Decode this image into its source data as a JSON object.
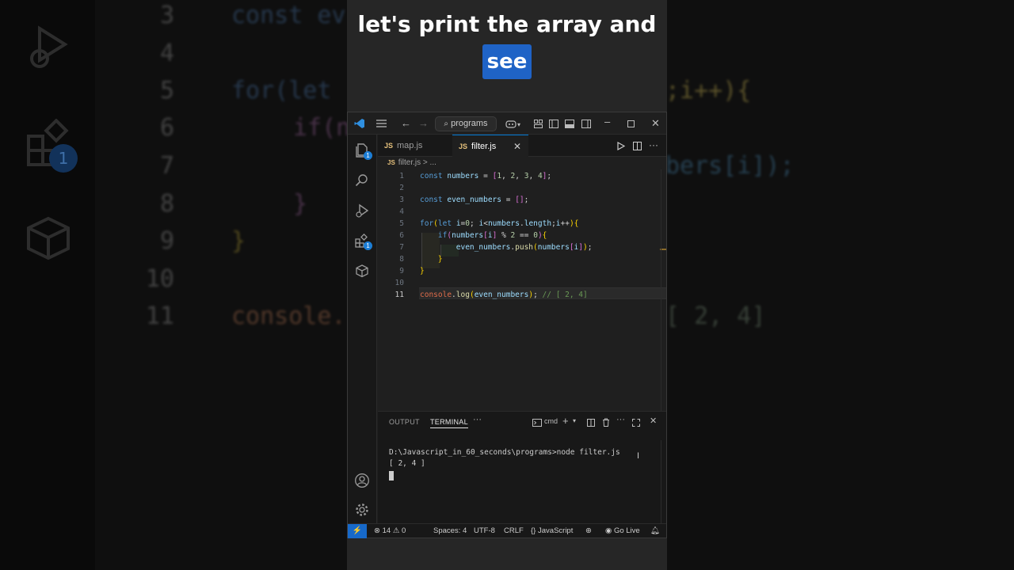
{
  "caption": {
    "line1": "let's print the array and",
    "line2": "see"
  },
  "titlebar": {
    "search_label": "programs"
  },
  "tabs": [
    {
      "label": "map.js",
      "lang": "JS"
    },
    {
      "label": "filter.js",
      "lang": "JS",
      "close": "✕"
    }
  ],
  "activity": {
    "explorer_badge": "1",
    "extensions_badge": "1"
  },
  "breadcrumb": {
    "lang": "JS",
    "file": "filter.js",
    "sep": " > ..."
  },
  "editor": {
    "line_numbers": [
      "1",
      "2",
      "3",
      "4",
      "5",
      "6",
      "7",
      "8",
      "9",
      "10",
      "11"
    ],
    "code": [
      "const numbers = [1, 2, 3, 4];",
      "",
      "const even_numbers = [];",
      "",
      "for(let i=0; i<numbers.length;i++){",
      "    if(numbers[i] % 2 == 0){",
      "        even_numbers.push(numbers[i]);",
      "    }",
      "}",
      "",
      "console.log(even_numbers); // [ 2, 4]"
    ]
  },
  "panel": {
    "tabs": {
      "output": "OUTPUT",
      "terminal": "TERMINAL",
      "more": "···"
    },
    "shell": "cmd",
    "terminal_lines": [
      "D:\\Javascript_in_60_seconds\\programs>node filter.js",
      "[ 2, 4 ]"
    ]
  },
  "status": {
    "errors": "14",
    "warnings": "0",
    "spaces": "Spaces: 4",
    "encoding": "UTF-8",
    "eol": "CRLF",
    "language": "JavaScript",
    "golive": "Go Live"
  },
  "background": {
    "line_numbers": [
      "3",
      "4",
      "5",
      "6",
      "7",
      "8",
      "9",
      "10",
      "11"
    ],
    "badge": "1"
  },
  "colors": {
    "accent": "#0078d4",
    "caption_highlight": "#1f63c6",
    "remote": "#1769c9"
  }
}
